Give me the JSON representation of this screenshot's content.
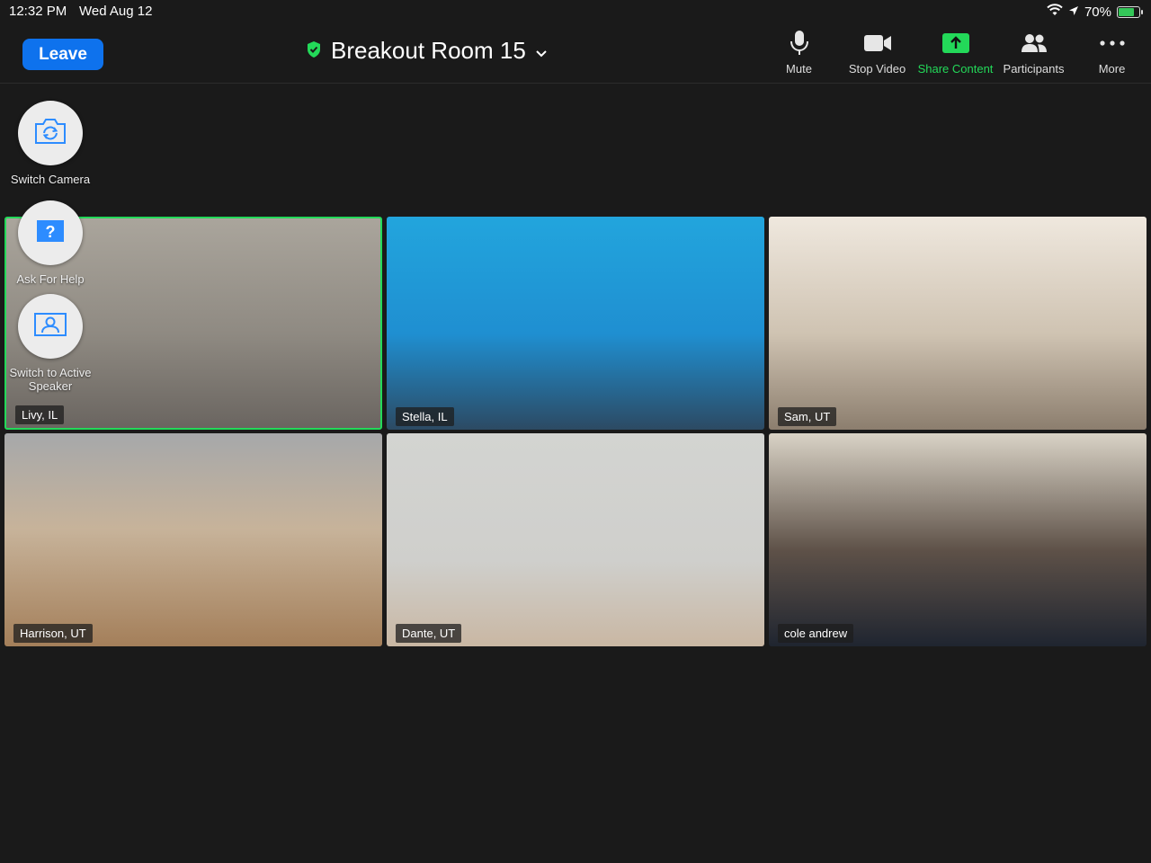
{
  "status_bar": {
    "time": "12:32 PM",
    "date": "Wed Aug 12",
    "battery_percent": "70%"
  },
  "toolbar": {
    "leave_label": "Leave",
    "meeting_title": "Breakout Room 15",
    "tools": {
      "mute": "Mute",
      "stop_video": "Stop Video",
      "share_content": "Share Content",
      "participants": "Participants",
      "more": "More"
    }
  },
  "side_controls": {
    "switch_camera": "Switch Camera",
    "ask_for_help": "Ask For Help",
    "switch_to_active_speaker": "Switch to Active Speaker"
  },
  "participants": [
    {
      "name": "Livy, IL"
    },
    {
      "name": "Stella, IL"
    },
    {
      "name": "Sam, UT"
    },
    {
      "name": "Harrison, UT"
    },
    {
      "name": "Dante, UT"
    },
    {
      "name": "cole andrew"
    }
  ],
  "colors": {
    "leave_button": "#0e72ed",
    "active_speaker_border": "#23d959",
    "share_content": "#23d959",
    "background": "#1a1a1a"
  }
}
